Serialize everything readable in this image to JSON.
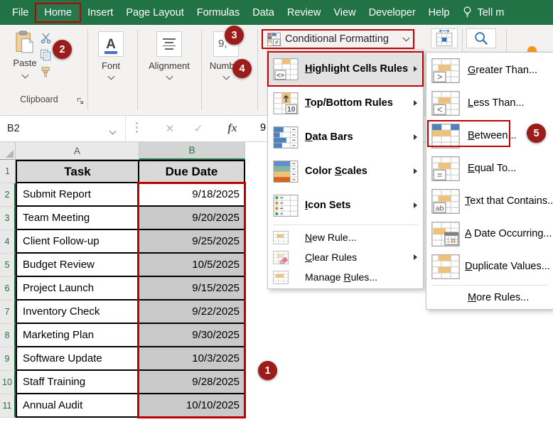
{
  "titlebar": {
    "tabs": [
      {
        "label": "File"
      },
      {
        "label": "Home",
        "active": true
      },
      {
        "label": "Insert"
      },
      {
        "label": "Page Layout"
      },
      {
        "label": "Formulas"
      },
      {
        "label": "Data"
      },
      {
        "label": "Review"
      },
      {
        "label": "View"
      },
      {
        "label": "Developer"
      },
      {
        "label": "Help"
      }
    ],
    "tell_me": "Tell m"
  },
  "ribbon": {
    "paste": "Paste",
    "clipboard": "Clipboard",
    "font_group": "Font",
    "alignment_group": "Alignment",
    "number_group": "Number",
    "number_icon_glyph": "9,",
    "conditional_formatting": "Conditional Formatting"
  },
  "formula_bar": {
    "name_box": "B2",
    "cancel": "✕",
    "enter": "✓",
    "fx": "fx",
    "value_partial": "9"
  },
  "cf_menu": {
    "items": [
      {
        "label": "Highlight Cells Rules",
        "accel": "H",
        "icon": "hcr",
        "bold": true,
        "submenu": true,
        "highlighted": true
      },
      {
        "label": "Top/Bottom Rules",
        "accel": "T",
        "icon": "topbottom",
        "bold": true,
        "submenu": true
      },
      {
        "label": "Data Bars",
        "accel": "D",
        "icon": "databars",
        "bold": true,
        "submenu": true
      },
      {
        "label": "Color Scales",
        "accel": "S",
        "icon": "colorscales",
        "bold": true,
        "submenu": true
      },
      {
        "label": "Icon Sets",
        "accel": "I",
        "icon": "iconsets",
        "bold": true,
        "submenu": true
      },
      {
        "separator": true
      },
      {
        "label": "New Rule...",
        "accel": "N",
        "icon": "newrule",
        "small": true
      },
      {
        "label": "Clear Rules",
        "accel": "C",
        "icon": "clearrules",
        "small": true,
        "submenu": true
      },
      {
        "label": "Manage Rules...",
        "accel": "R",
        "icon": "managerules",
        "small": true
      }
    ]
  },
  "hcr_submenu": {
    "items": [
      {
        "label": "Greater Than...",
        "accel": "G",
        "icon": "gt"
      },
      {
        "label": "Less Than...",
        "accel": "L",
        "icon": "lt"
      },
      {
        "label": "Between...",
        "accel": "B",
        "icon": "between",
        "annotated": true
      },
      {
        "label": "Equal To...",
        "accel": "E",
        "icon": "eq"
      },
      {
        "label": "Text that Contains...",
        "accel": "T",
        "icon": "text"
      },
      {
        "label": "A Date Occurring...",
        "accel": "A",
        "icon": "date"
      },
      {
        "label": "Duplicate Values...",
        "accel": "D",
        "icon": "dup"
      },
      {
        "separator": true
      },
      {
        "label": "More Rules...",
        "accel": "M",
        "icon": null,
        "small": true
      }
    ]
  },
  "sheet": {
    "col_headers": [
      {
        "label": "A"
      },
      {
        "label": "B",
        "selected": true
      }
    ],
    "rows": [
      {
        "num": "1",
        "task": "Task",
        "date": "Due Date",
        "header": true
      },
      {
        "num": "2",
        "task": "Submit Report",
        "date": "9/18/2025",
        "selected": true,
        "active_cell": true
      },
      {
        "num": "3",
        "task": "Team Meeting",
        "date": "9/20/2025",
        "selected": true
      },
      {
        "num": "4",
        "task": "Client Follow-up",
        "date": "9/25/2025",
        "selected": true
      },
      {
        "num": "5",
        "task": "Budget Review",
        "date": "10/5/2025",
        "selected": true
      },
      {
        "num": "6",
        "task": "Project Launch",
        "date": "9/15/2025",
        "selected": true
      },
      {
        "num": "7",
        "task": "Inventory Check",
        "date": "9/22/2025",
        "selected": true
      },
      {
        "num": "8",
        "task": "Marketing Plan",
        "date": "9/30/2025",
        "selected": true
      },
      {
        "num": "9",
        "task": "Software Update",
        "date": "10/3/2025",
        "selected": true
      },
      {
        "num": "10",
        "task": "Staff Training",
        "date": "9/28/2025",
        "selected": true
      },
      {
        "num": "11",
        "task": "Annual Audit",
        "date": "10/10/2025",
        "selected": true
      }
    ]
  },
  "annotations": {
    "badges": [
      "1",
      "2",
      "3",
      "4",
      "5"
    ],
    "colors": {
      "annotation_red": "#c00000",
      "badge_red": "#9c1c1c"
    }
  },
  "colors": {
    "excel_green": "#217346",
    "selection_gray": "#c9c9c9",
    "header_fill": "#d9d9d9"
  }
}
